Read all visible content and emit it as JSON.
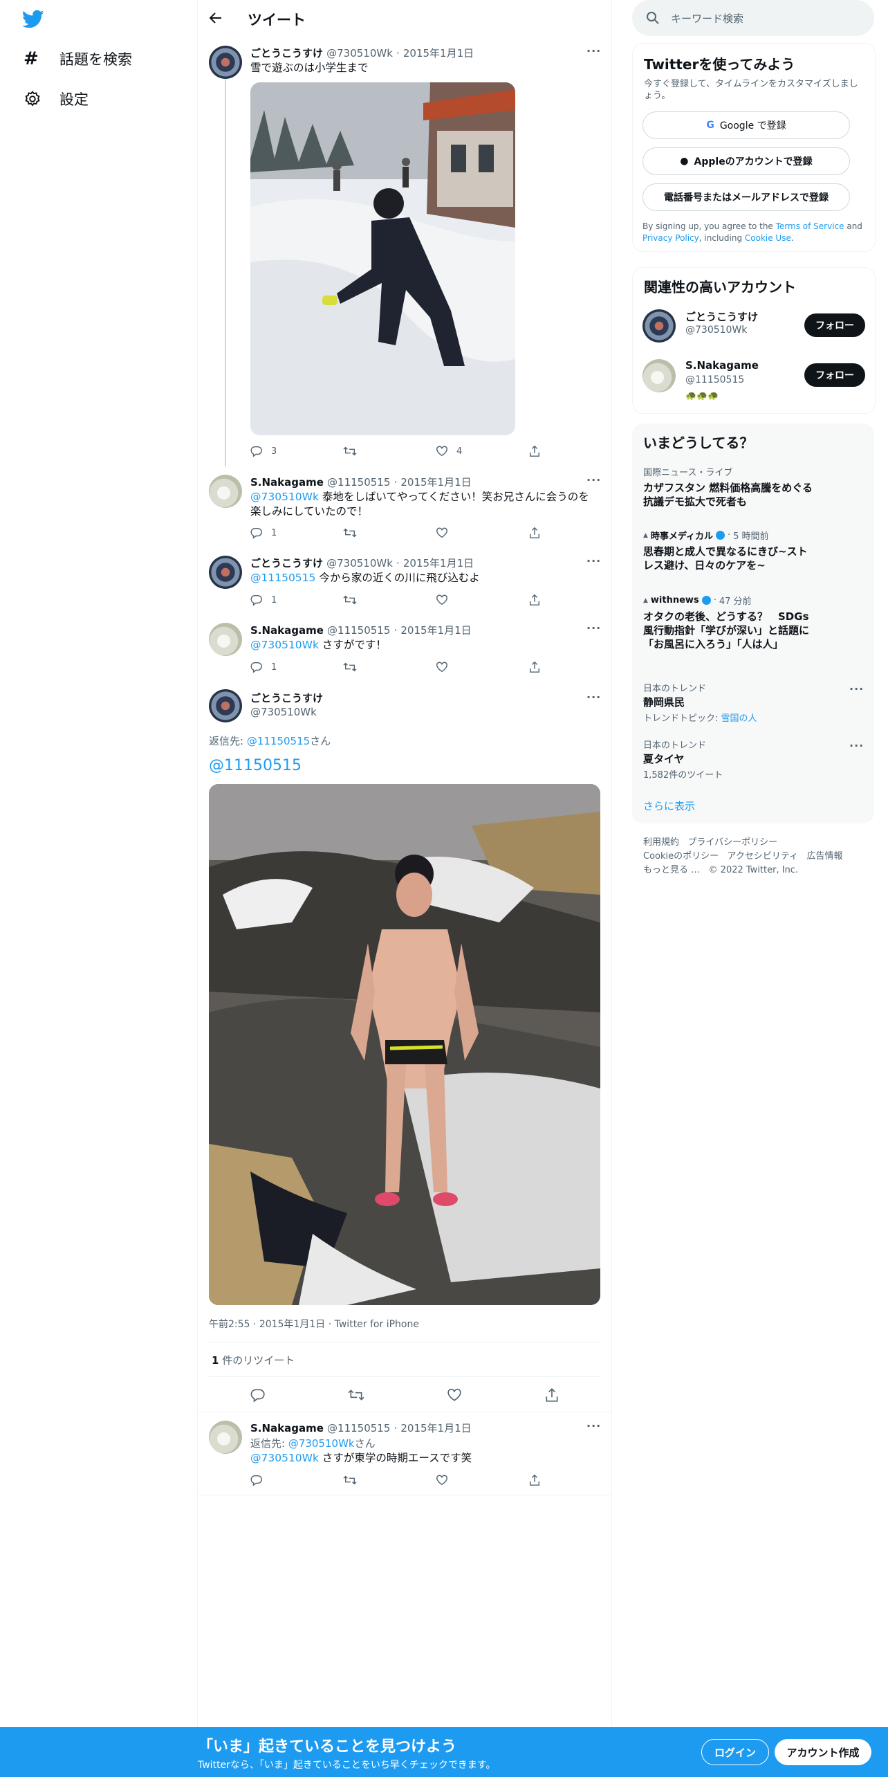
{
  "nav": {
    "explore_label": "話題を検索",
    "settings_label": "設定"
  },
  "header": {
    "title": "ツイート"
  },
  "tweets": [
    {
      "name": "ごとうこうすけ",
      "handle": "@730510Wk",
      "date": "2015年1月1日",
      "text": "雪で遊ぶのは小学生まで",
      "replies": "3",
      "retweets": "",
      "likes": "4"
    },
    {
      "name": "S.Nakagame",
      "handle": "@11150515",
      "date": "2015年1月1日",
      "mention": "@730510Wk",
      "text": "泰地をしばいてやってください！笑お兄さんに会うのを楽しみにしていたので！",
      "replies": "1"
    },
    {
      "name": "ごとうこうすけ",
      "handle": "@730510Wk",
      "date": "2015年1月1日",
      "mention": "@11150515",
      "text": "今から家の近くの川に飛び込むよ",
      "replies": "1"
    },
    {
      "name": "S.Nakagame",
      "handle": "@11150515",
      "date": "2015年1月1日",
      "mention": "@730510Wk",
      "text": "さすがです！",
      "replies": "1"
    }
  ],
  "focus": {
    "name": "ごとうこうすけ",
    "handle": "@730510Wk",
    "reply_to_prefix": "返信先: ",
    "reply_to_handle": "@11150515",
    "reply_to_suffix": "さん",
    "text": "@11150515",
    "time": "午前2:55",
    "date": "2015年1月1日",
    "client": "Twitter for iPhone",
    "retweet_count": "1",
    "retweet_label": "件のリツイート"
  },
  "reply": {
    "name": "S.Nakagame",
    "handle": "@11150515",
    "date": "2015年1月1日",
    "reply_to_prefix": "返信先: ",
    "reply_to_handle": "@730510Wk",
    "reply_to_suffix": "さん",
    "mention": "@730510Wk",
    "text": "さすが東学の時期エースです笑"
  },
  "search": {
    "placeholder": "キーワード検索"
  },
  "signup": {
    "title": "Twitterを使ってみよう",
    "subtitle": "今すぐ登録して、タイムラインをカスタマイズしましょう。",
    "google": "Google で登録",
    "apple": "Appleのアカウントで登録",
    "phone": "電話番号またはメールアドレスで登録",
    "legal_1": "By signing up, you agree to the ",
    "tos": "Terms of Service",
    "legal_2": " and ",
    "privacy": "Privacy Policy",
    "legal_3": ", including ",
    "cookie": "Cookie Use",
    "legal_4": "."
  },
  "related": {
    "title": "関連性の高いアカウント",
    "accounts": [
      {
        "name": "ごとうこうすけ",
        "handle": "@730510Wk",
        "bio": "",
        "follow": "フォロー"
      },
      {
        "name": "S.Nakagame",
        "handle": "@11150515",
        "bio": "🐢🐢🐢",
        "follow": "フォロー"
      }
    ]
  },
  "trends": {
    "title": "いまどうしてる？",
    "items": [
      {
        "category": "国際ニュース・ライブ",
        "title": "カザフスタン 燃料価格高騰をめぐる抗議デモ拡大で死者も"
      },
      {
        "source": "時事メディカル",
        "time": "5 時間前",
        "title": "思春期と成人で異なるにきび~ストレス避け、日々のケアを~"
      },
      {
        "source": "withnews",
        "time": "47 分前",
        "title": "オタクの老後、どうする？　SDGs風行動指針「学びが深い」と話題に　「お風呂に入ろう」「人は人」"
      },
      {
        "category": "日本のトレンド",
        "title": "静岡県民",
        "topic_label": "トレンドトピック: ",
        "topic": "雪国の人"
      },
      {
        "category": "日本のトレンド",
        "title": "夏タイヤ",
        "count": "1,582件のツイート"
      }
    ],
    "more": "さらに表示"
  },
  "footer": {
    "links": [
      "利用規約",
      "プライバシーポリシー",
      "Cookieのポリシー",
      "アクセシビリティ",
      "広告情報",
      "もっと見る …"
    ],
    "copyright": "© 2022 Twitter, Inc."
  },
  "bottom": {
    "headline": "「いま」起きていることを見つけよう",
    "sub": "Twitterなら、「いま」起きていることをいち早くチェックできます。",
    "login": "ログイン",
    "signup": "アカウント作成"
  },
  "colors": {
    "accent": "#1d9bf0",
    "text": "#0f1419",
    "muted": "#536471"
  }
}
